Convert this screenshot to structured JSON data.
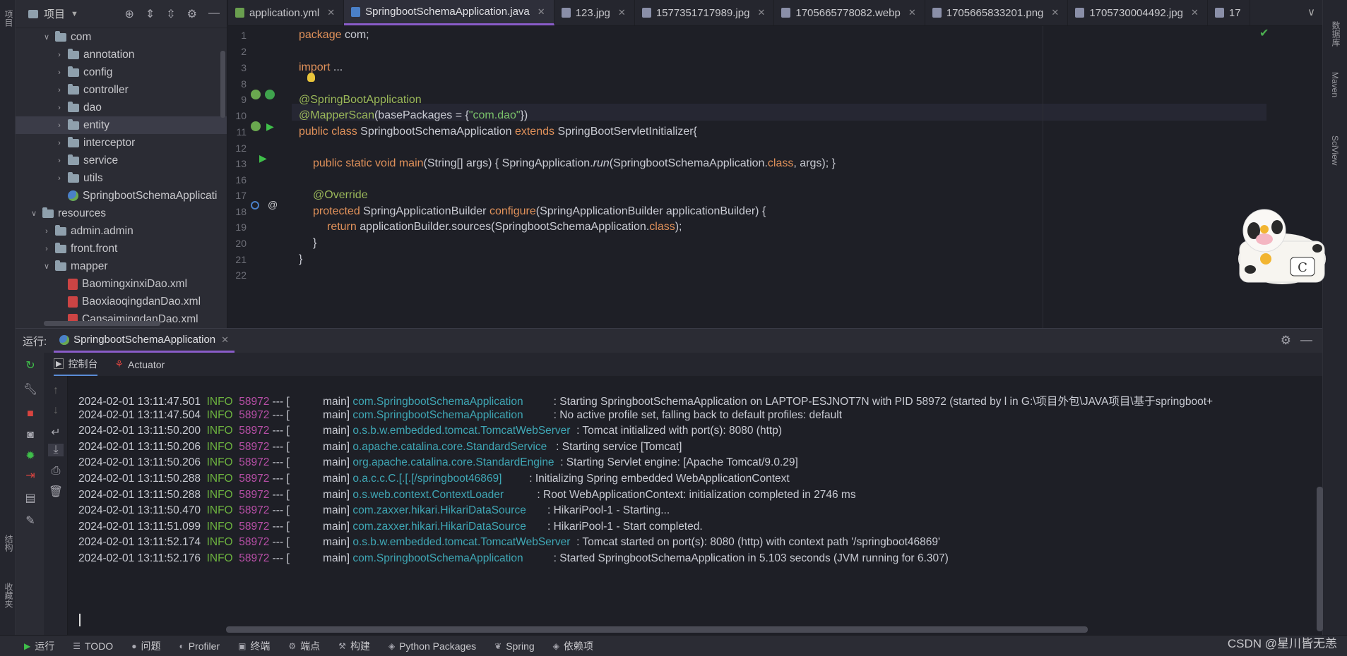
{
  "left_stripe": {
    "project_label": "项目",
    "structure_label": "结构",
    "favorites_label": "收藏夹"
  },
  "right_stripe": {
    "db_label": "数据库",
    "maven_label": "Maven",
    "sciview_label": "SciView"
  },
  "project_panel": {
    "title": "项目",
    "tree": [
      {
        "label": "com",
        "level": 1,
        "type": "folder",
        "expanded": true
      },
      {
        "label": "annotation",
        "level": 2,
        "type": "folder"
      },
      {
        "label": "config",
        "level": 2,
        "type": "folder"
      },
      {
        "label": "controller",
        "level": 2,
        "type": "folder"
      },
      {
        "label": "dao",
        "level": 2,
        "type": "folder"
      },
      {
        "label": "entity",
        "level": 2,
        "type": "folder",
        "selected": true
      },
      {
        "label": "interceptor",
        "level": 2,
        "type": "folder"
      },
      {
        "label": "service",
        "level": 2,
        "type": "folder"
      },
      {
        "label": "utils",
        "level": 2,
        "type": "folder"
      },
      {
        "label": "SpringbootSchemaApplicati",
        "level": 2,
        "type": "spring"
      },
      {
        "label": "resources",
        "level": 0,
        "type": "folder",
        "expanded": true
      },
      {
        "label": "admin.admin",
        "level": 1,
        "type": "folder"
      },
      {
        "label": "front.front",
        "level": 1,
        "type": "folder"
      },
      {
        "label": "mapper",
        "level": 1,
        "type": "folder",
        "expanded": true
      },
      {
        "label": "BaomingxinxiDao.xml",
        "level": 2,
        "type": "xml"
      },
      {
        "label": "BaoxiaoqingdanDao.xml",
        "level": 2,
        "type": "xml"
      },
      {
        "label": "CansaimingdanDao.xml",
        "level": 2,
        "type": "xml"
      }
    ]
  },
  "editor_tabs": [
    {
      "label": "application.yml",
      "active": false,
      "color": "#6a9f4f"
    },
    {
      "label": "SpringbootSchemaApplication.java",
      "active": true,
      "color": "#4a80c8"
    },
    {
      "label": "123.jpg",
      "active": false,
      "color": "#8a8fa8"
    },
    {
      "label": "1577351717989.jpg",
      "active": false,
      "color": "#8a8fa8"
    },
    {
      "label": "1705665778082.webp",
      "active": false,
      "color": "#8a8fa8"
    },
    {
      "label": "1705665833201.png",
      "active": false,
      "color": "#8a8fa8"
    },
    {
      "label": "1705730004492.jpg",
      "active": false,
      "color": "#8a8fa8"
    },
    {
      "label": "17",
      "active": false,
      "color": "#8a8fa8"
    }
  ],
  "editor": {
    "line_numbers": [
      "1",
      "2",
      "3",
      "8",
      "9",
      "10",
      "11",
      "12",
      "13",
      "16",
      "17",
      "18",
      "19",
      "20",
      "21",
      "22"
    ],
    "code": {
      "l1_kw": "package",
      "l1_rest": " com;",
      "l3_kw": "import",
      "l3_rest": " ...",
      "l9": "@SpringBootApplication",
      "l10_ann": "@MapperScan",
      "l10_a": "(basePackages = {",
      "l10_str": "\"com.dao\"",
      "l10_b": "})",
      "l11_kw": "public class",
      "l11_name": " SpringbootSchemaApplication ",
      "l11_kw2": "extends",
      "l11_rest": " SpringBootServletInitializer{",
      "l13_kw": "public static void",
      "l13_fn": " main",
      "l13_a": "(String[] args) { SpringApplication.",
      "l13_run": "run",
      "l13_b": "(SpringbootSchemaApplication.",
      "l13_cls": "class",
      "l13_c": ", args); }",
      "l17": "@Override",
      "l18_kw": "protected",
      "l18_a": " SpringApplicationBuilder ",
      "l18_fn": "configure",
      "l18_b": "(SpringApplicationBuilder applicationBuilder) {",
      "l19_kw": "return",
      "l19_a": " applicationBuilder.sources(SpringbootSchemaApplication.",
      "l19_cls": "class",
      "l19_b": ");",
      "l20": "}",
      "l21": "}"
    }
  },
  "run_panel": {
    "label": "运行:",
    "tab": "SpringbootSchemaApplication",
    "subtabs": [
      "控制台",
      "Actuator"
    ]
  },
  "console": {
    "logs": [
      {
        "ts": "2024-02-01 13:11:47.501",
        "level": "INFO",
        "pid": "58972",
        "thread": " --- [           main] ",
        "logger": "com.SpringbootSchemaApplication",
        "pad": "          ",
        "msg": ": Starting SpringbootSchemaApplication on LAPTOP-ESJNOT7N with PID 58972 (started by l in G:\\项目外包\\JAVA项目\\基于springboot+"
      },
      {
        "ts": "2024-02-01 13:11:47.504",
        "level": "INFO",
        "pid": "58972",
        "thread": " --- [           main] ",
        "logger": "com.SpringbootSchemaApplication",
        "pad": "          ",
        "msg": ": No active profile set, falling back to default profiles: default"
      },
      {
        "ts": "2024-02-01 13:11:50.200",
        "level": "INFO",
        "pid": "58972",
        "thread": " --- [           main] ",
        "logger": "o.s.b.w.embedded.tomcat.TomcatWebServer",
        "pad": "  ",
        "msg": ": Tomcat initialized with port(s): 8080 (http)"
      },
      {
        "ts": "2024-02-01 13:11:50.206",
        "level": "INFO",
        "pid": "58972",
        "thread": " --- [           main] ",
        "logger": "o.apache.catalina.core.StandardService",
        "pad": "   ",
        "msg": ": Starting service [Tomcat]"
      },
      {
        "ts": "2024-02-01 13:11:50.206",
        "level": "INFO",
        "pid": "58972",
        "thread": " --- [           main] ",
        "logger": "org.apache.catalina.core.StandardEngine",
        "pad": "  ",
        "msg": ": Starting Servlet engine: [Apache Tomcat/9.0.29]"
      },
      {
        "ts": "2024-02-01 13:11:50.288",
        "level": "INFO",
        "pid": "58972",
        "thread": " --- [           main] ",
        "logger": "o.a.c.c.C.[.[.[/springboot46869]",
        "pad": "         ",
        "msg": ": Initializing Spring embedded WebApplicationContext"
      },
      {
        "ts": "2024-02-01 13:11:50.288",
        "level": "INFO",
        "pid": "58972",
        "thread": " --- [           main] ",
        "logger": "o.s.web.context.ContextLoader",
        "pad": "           ",
        "msg": ": Root WebApplicationContext: initialization completed in 2746 ms"
      },
      {
        "ts": "2024-02-01 13:11:50.470",
        "level": "INFO",
        "pid": "58972",
        "thread": " --- [           main] ",
        "logger": "com.zaxxer.hikari.HikariDataSource",
        "pad": "       ",
        "msg": ": HikariPool-1 - Starting..."
      },
      {
        "ts": "2024-02-01 13:11:51.099",
        "level": "INFO",
        "pid": "58972",
        "thread": " --- [           main] ",
        "logger": "com.zaxxer.hikari.HikariDataSource",
        "pad": "       ",
        "msg": ": HikariPool-1 - Start completed."
      },
      {
        "ts": "2024-02-01 13:11:52.174",
        "level": "INFO",
        "pid": "58972",
        "thread": " --- [           main] ",
        "logger": "o.s.b.w.embedded.tomcat.TomcatWebServer",
        "pad": "  ",
        "msg": ": Tomcat started on port(s): 8080 (http) with context path '/springboot46869'"
      },
      {
        "ts": "2024-02-01 13:11:52.176",
        "level": "INFO",
        "pid": "58972",
        "thread": " --- [           main] ",
        "logger": "com.SpringbootSchemaApplication",
        "pad": "          ",
        "msg": ": Started SpringbootSchemaApplication in 5.103 seconds (JVM running for 6.307)"
      }
    ]
  },
  "status_bar": {
    "items": [
      "运行",
      "TODO",
      "问题",
      "Profiler",
      "终端",
      "端点",
      "构建",
      "Python Packages",
      "Spring",
      "依赖项"
    ],
    "watermark": "CSDN @星川皆无恙"
  },
  "colors": {
    "accent": "#8a5cc9",
    "info": "#6db33f",
    "pid": "#b84fa7",
    "logger": "#3fa7b5",
    "keyword": "#e0915a",
    "annotation": "#9bb85a"
  }
}
